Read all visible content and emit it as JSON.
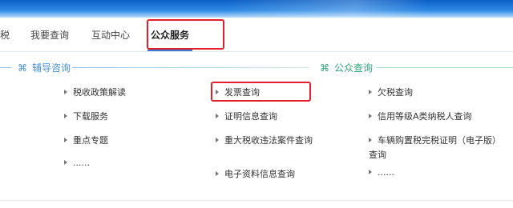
{
  "nav": {
    "tabs": [
      {
        "label": "税"
      },
      {
        "label": "我要查询"
      },
      {
        "label": "互动中心"
      },
      {
        "label": "公众服务"
      }
    ]
  },
  "sections": {
    "left": {
      "icon": "command-icon",
      "symbol": "⌘",
      "title": "辅导咨询",
      "color": "#4a8fd8"
    },
    "right": {
      "icon": "command-icon",
      "symbol": "⌘",
      "title": "公众查询",
      "color": "#2fa67a"
    }
  },
  "columns": {
    "col1": [
      "税收政策解读",
      "下载服务",
      "重点专题",
      "......"
    ],
    "col2": [
      "发票查询",
      "证明信息查询",
      "重大税收违法案件查询",
      "电子资料信息查询"
    ],
    "col3": [
      "欠税查询",
      "信用等级A类纳税人查询",
      "车辆购置税完税证明（电子版）查询",
      "......"
    ]
  },
  "highlight_color": "#e0212b"
}
